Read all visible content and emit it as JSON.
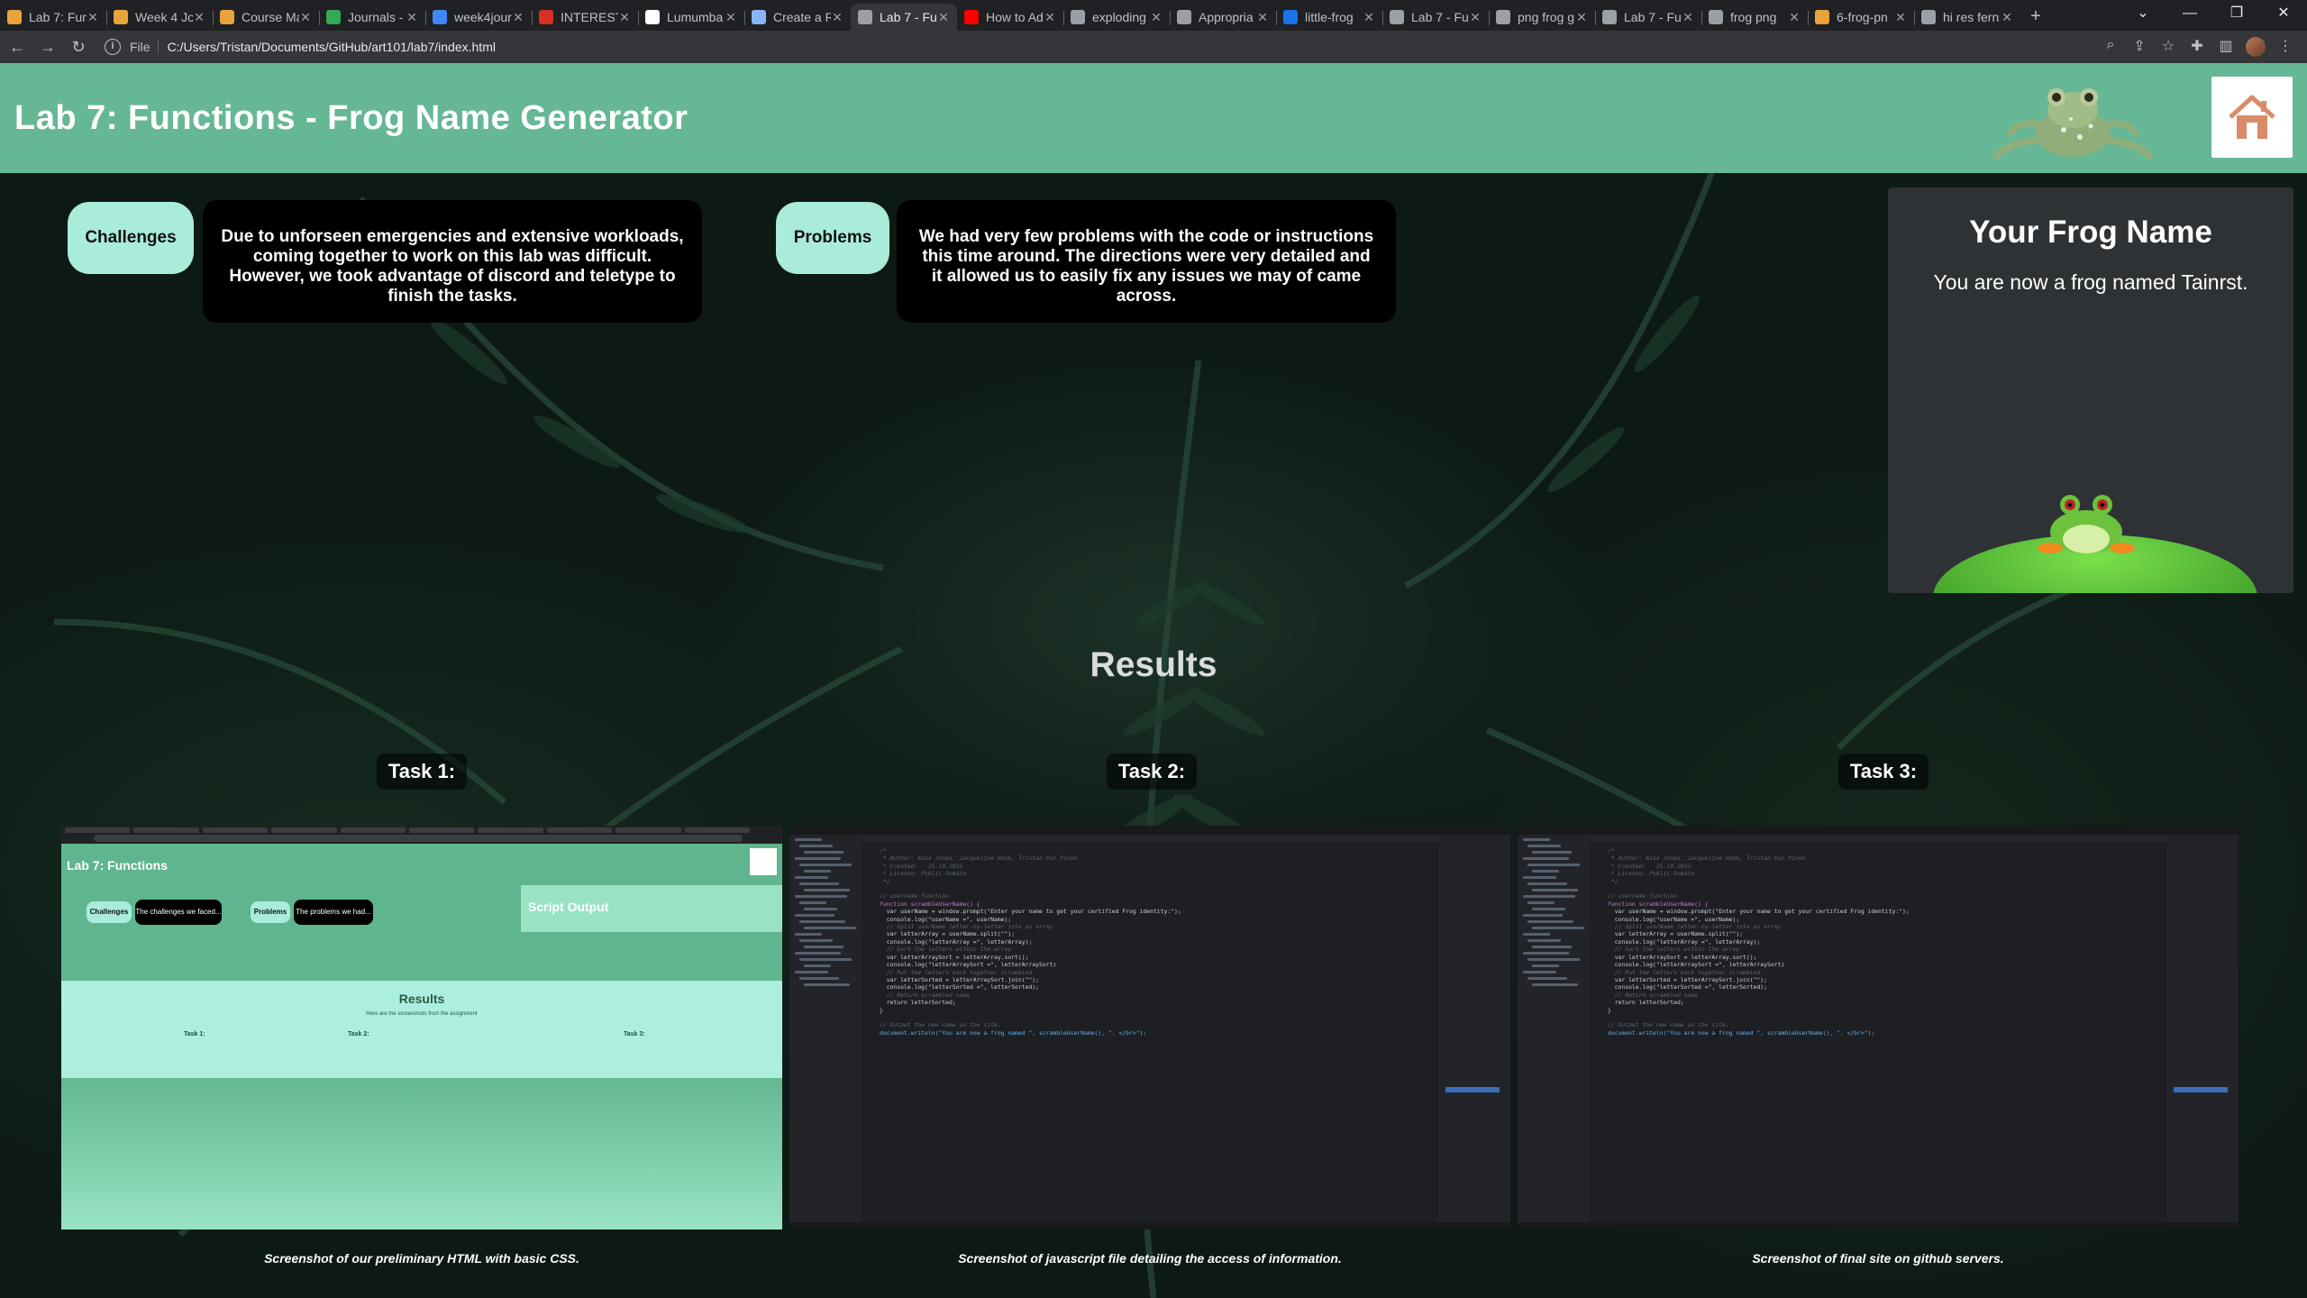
{
  "browser": {
    "tabs": [
      {
        "title": "Lab 7: Fun",
        "color": "#e8a33d"
      },
      {
        "title": "Week 4 Jo",
        "color": "#e8a33d"
      },
      {
        "title": "Course Ma",
        "color": "#e8a33d"
      },
      {
        "title": "Journals -",
        "color": "#34a853"
      },
      {
        "title": "week4jour",
        "color": "#4285f4"
      },
      {
        "title": "INTERESTI",
        "color": "#d93025"
      },
      {
        "title": "Lumumba",
        "color": "#ffffff"
      },
      {
        "title": "Create a R",
        "color": "#8ab4f8"
      },
      {
        "title": "Lab 7 - Fu",
        "color": "#9aa0a6"
      },
      {
        "title": "How to Ad",
        "color": "#ff0000"
      },
      {
        "title": "exploding",
        "color": "#9aa0a6"
      },
      {
        "title": "Appropria",
        "color": "#9aa0a6"
      },
      {
        "title": "little-frog",
        "color": "#1a73e8"
      },
      {
        "title": "Lab 7 - Fu",
        "color": "#9aa0a6"
      },
      {
        "title": "png frog g",
        "color": "#9aa0a6"
      },
      {
        "title": "Lab 7 - Fu",
        "color": "#9aa0a6"
      },
      {
        "title": "frog png",
        "color": "#9aa0a6"
      },
      {
        "title": "6-frog-pn",
        "color": "#e8a33d"
      },
      {
        "title": "hi res fern",
        "color": "#9aa0a6"
      }
    ],
    "active_tab_index": 8,
    "address_scheme": "File",
    "address": "C:/Users/Tristan/Documents/GitHub/art101/lab7/index.html"
  },
  "page": {
    "title": "Lab 7: Functions - Frog Name Generator",
    "header_color": "#66b795",
    "challenges": {
      "label": "Challenges",
      "text": "Due to unforseen emergencies and extensive workloads, coming together to work on this lab was difficult. However, we took advantage of discord and teletype to finish the tasks."
    },
    "problems": {
      "label": "Problems",
      "text": "We had very few problems with the code or instructions this time around. The directions were very detailed and it allowed us to easily fix any issues we may of came across."
    },
    "frog_panel": {
      "title": "Your Frog Name",
      "output": "You are now a frog named Tainrst."
    },
    "results": {
      "heading": "Results",
      "tasks": [
        {
          "label": "Task 1:",
          "caption": "Screenshot of our preliminary HTML with basic CSS."
        },
        {
          "label": "Task 2:",
          "caption": "Screenshot of javascript file detailing the access of information."
        },
        {
          "label": "Task 3:",
          "caption": "Screenshot of final site on github servers."
        }
      ]
    }
  },
  "screenshot1": {
    "title": "Lab 7: Functions",
    "challenges_label": "Challenges",
    "challenges_text": "The challenges we faced...",
    "problems_label": "Problems",
    "problems_text": "The problems we had...",
    "script_output": "Script Output",
    "results_title": "Results",
    "results_sub": "Here are the screenshots from the assignment",
    "task1": "Task 1:",
    "task2": "Task 2:",
    "task3": "Task 3:"
  },
  "code_lines": [
    {
      "cls": "c",
      "text": "/*"
    },
    {
      "cls": "c",
      "text": " * Author: Alex Jones, Jacqueline Hook, Tristan Van Pinen"
    },
    {
      "cls": "c",
      "text": " * Created:   25.10.2022"
    },
    {
      "cls": "c",
      "text": " * License: Public Domain"
    },
    {
      "cls": "c",
      "text": " */"
    },
    {
      "cls": "",
      "text": ""
    },
    {
      "cls": "c",
      "text": "// username function"
    },
    {
      "cls": "k",
      "text": "function scrambleUserName() {"
    },
    {
      "cls": "",
      "text": "  var userName = window.prompt(\"Enter your name to get your certified Frog identity:\");"
    },
    {
      "cls": "",
      "text": "  console.log(\"userName =\", userName);"
    },
    {
      "cls": "c",
      "text": "  // Split userName letter-by-letter into an array"
    },
    {
      "cls": "",
      "text": "  var letterArray = userName.split(\"\");"
    },
    {
      "cls": "",
      "text": "  console.log(\"letterArray =\", letterArray);"
    },
    {
      "cls": "c",
      "text": "  // Sort the letters within the array"
    },
    {
      "cls": "",
      "text": "  var letterArraySort = letterArray.sort();"
    },
    {
      "cls": "",
      "text": "  console.log(\"letterArraySort =\", letterArraySort)"
    },
    {
      "cls": "c",
      "text": "  // Put the letters back together scrambled"
    },
    {
      "cls": "",
      "text": "  var letterSorted = letterArraySort.join(\"\");"
    },
    {
      "cls": "",
      "text": "  console.log(\"letterSorted =\", letterSorted);"
    },
    {
      "cls": "c",
      "text": "  // Return scrambled name"
    },
    {
      "cls": "",
      "text": "  return letterSorted;"
    },
    {
      "cls": "",
      "text": "}"
    },
    {
      "cls": "",
      "text": ""
    },
    {
      "cls": "c",
      "text": "// Output the new name on the site."
    },
    {
      "cls": "f",
      "text": "document.writeln(\"You are now a frog named \", scrambleUserName(), \". </br>\");"
    }
  ]
}
